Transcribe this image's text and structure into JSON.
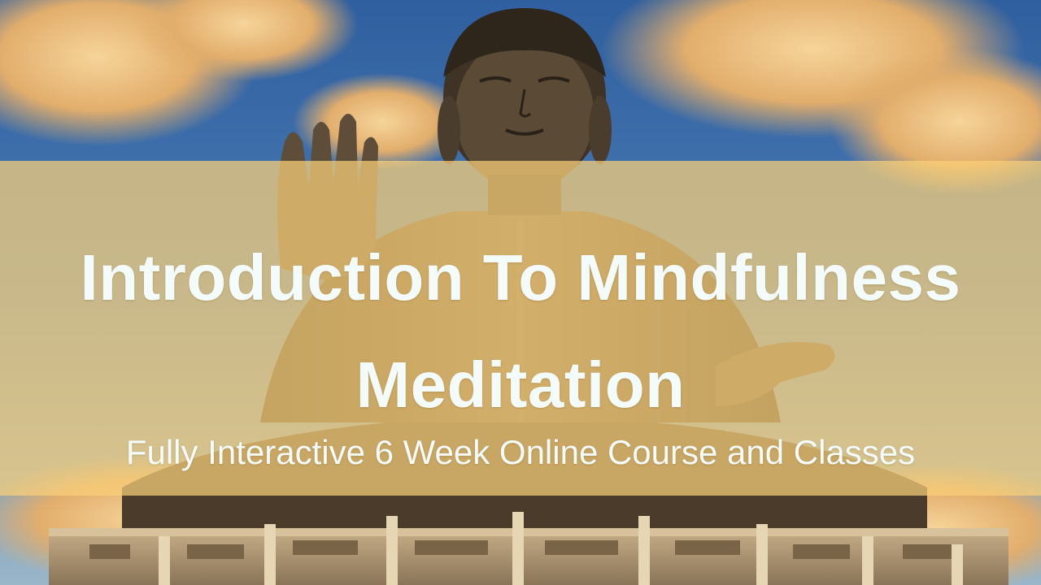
{
  "title": {
    "line1": "Introduction To Mindfulness",
    "line2": "Meditation"
  },
  "subtitle": "Fully Interactive 6 Week Online Course and Classes",
  "colors": {
    "sky": "#3f6fa8",
    "cloud": "#e8b46a",
    "banner": "#fad078",
    "statue": "#5a4a36",
    "text": "#f3fbfb"
  }
}
